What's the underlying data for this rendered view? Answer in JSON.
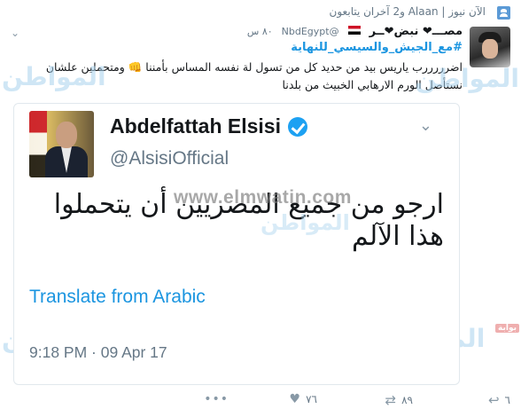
{
  "retweet_context": {
    "icon": "person-icon",
    "text": "الآن نيوز | Alaan و2 آخران يتابعون"
  },
  "tweet": {
    "author_name": "مصـــ❤ نبض❤ــر",
    "handle": "@NbdEgypt",
    "time": "٨٠ س",
    "hashtag": "#مع_الجيش_والسيسي_للنهاية",
    "body": "اضرررررب ياريس بيد من حديد كل من تسول لة نفسه المساس بأمننا 👊 ومتحملين علشان نستأصل الورم الارهابي الخبيث من بلدنا"
  },
  "quoted_tweet": {
    "name": "Abdelfattah Elsisi",
    "handle": "@AlsisiOfficial",
    "text": "ارجو من جميع المصريين أن يتحملوا هذا الآلم",
    "translate_label": "Translate from Arabic",
    "timestamp": "9:18 PM · 09 Apr 17"
  },
  "actions": {
    "reply_count": "٦",
    "retweet_count": "٨٩",
    "like_count": "٧٦"
  },
  "watermark": {
    "text": "المواطن",
    "badge": "بوابة",
    "url": "www.elmwatin.com"
  },
  "colors": {
    "link_blue": "#1b95e0",
    "verified_blue": "#1da1f2",
    "muted_gray": "#657786",
    "heart_red": "#e0245e"
  }
}
